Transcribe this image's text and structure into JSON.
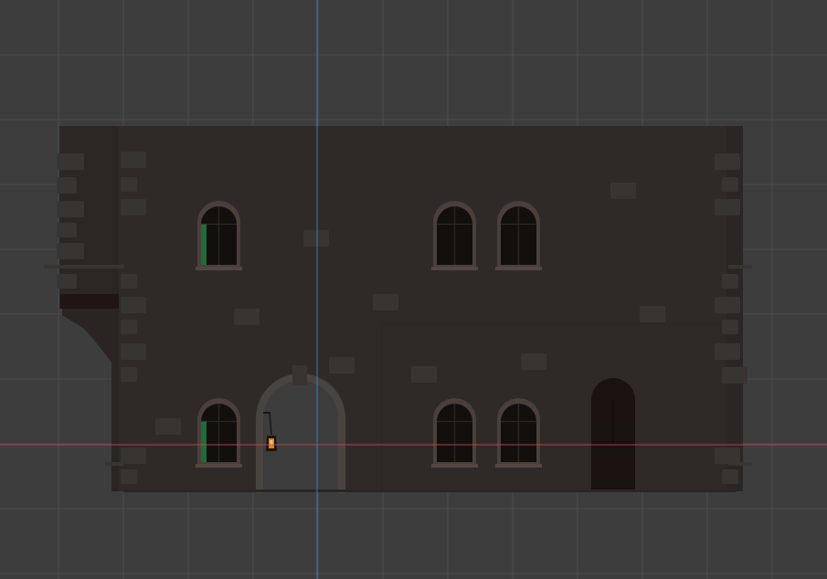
{
  "viewport": {
    "mode": "orthographic-front",
    "grid_visible": true,
    "axes": {
      "x_axis_color": "#b84a4a",
      "z_axis_color": "#3f7fc9"
    }
  },
  "scene": {
    "object": "stone-building-facade",
    "colors": {
      "background": "#3d3d3d",
      "grid_minor": "#454545",
      "grid_major": "#4d4d4d",
      "wall": "#2f2a27",
      "wall_shadow": "#27221f",
      "stone": "#363331",
      "window_frame": "#4a4039",
      "window_glass": "#120f0d",
      "shutter_green": "#1f6b3a",
      "door": "#1a1210",
      "lantern_light": "#e07a2a"
    },
    "windows_upper": 3,
    "windows_lower": 3,
    "has_arch_gate": true,
    "has_door": true,
    "has_lantern": true
  }
}
